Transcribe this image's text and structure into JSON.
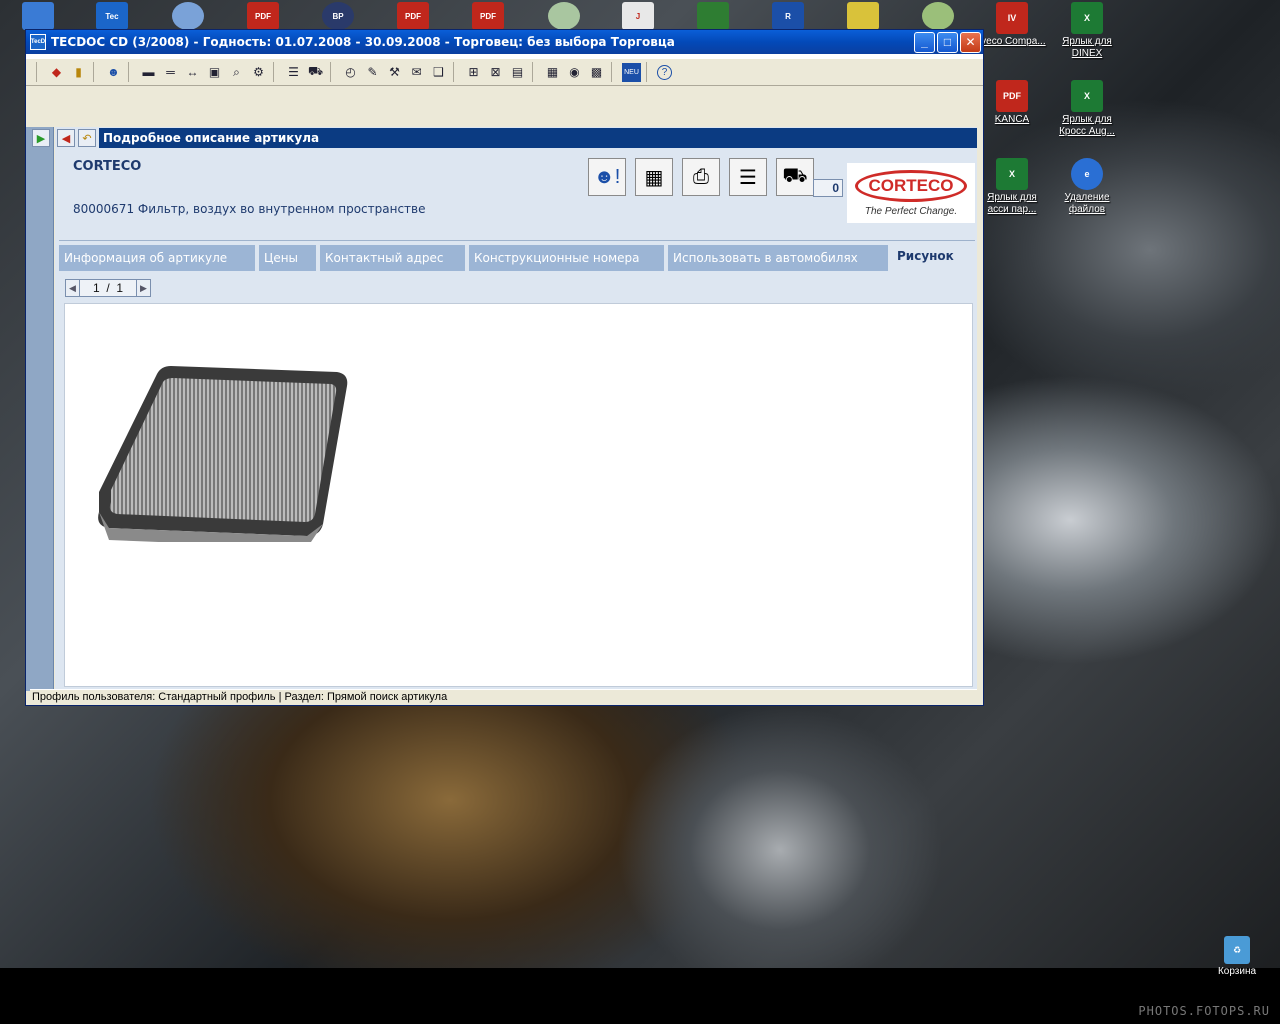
{
  "desktop": {
    "right_icons": [
      {
        "label": "Iveco Compa...",
        "icon": "iveco-icon",
        "color": "#c0271c"
      },
      {
        "label": "Ярлык для DINEX",
        "icon": "excel-shortcut-icon",
        "color": "#1d7a34"
      },
      {
        "label": "KANCA",
        "icon": "pdf-icon",
        "color": "#c0271c"
      },
      {
        "label": "Ярлык для Кросс Aug...",
        "icon": "excel-shortcut-icon",
        "color": "#1d7a34"
      },
      {
        "label": "Ярлык для асси пар...",
        "icon": "excel-shortcut-icon",
        "color": "#1d7a34"
      },
      {
        "label": "Удаление файлов",
        "icon": "ie-icon",
        "color": "#2a6fd4"
      }
    ],
    "left_fragments": [],
    "recycle_bin": "Корзина",
    "watermark": "PHOTOS.FOTOPS.RU"
  },
  "window": {
    "title": "TECDOC CD (3/2008)  -  Годность: 01.07.2008 - 30.09.2008  -  Торговец: без выбора Торговца",
    "minimize": "0",
    "maximize": "1",
    "close": "r"
  },
  "menu": {
    "row1": [],
    "row2": []
  },
  "section_title": "Подробное описание артикула",
  "article": {
    "brand": "CORTECO",
    "description": "80000671 Фильтр, воздух во внутренном пространстве",
    "quantity": "0",
    "logo_text": "CORTECO",
    "logo_tagline": "The Perfect Change."
  },
  "tabs": [
    {
      "label": "Информация об артикуле",
      "active": false
    },
    {
      "label": "Цены",
      "active": false
    },
    {
      "label": "Контактный адрес",
      "active": false
    },
    {
      "label": "Конструкционные номера",
      "active": false
    },
    {
      "label": "Использовать в автомобилях",
      "active": false
    },
    {
      "label": "Рисунок",
      "active": true
    }
  ],
  "pager": {
    "current": "1",
    "sep": "/",
    "total": "1"
  },
  "status": "Профиль пользователя: Стандартный профиль | Раздел: Прямой поиск артикула"
}
